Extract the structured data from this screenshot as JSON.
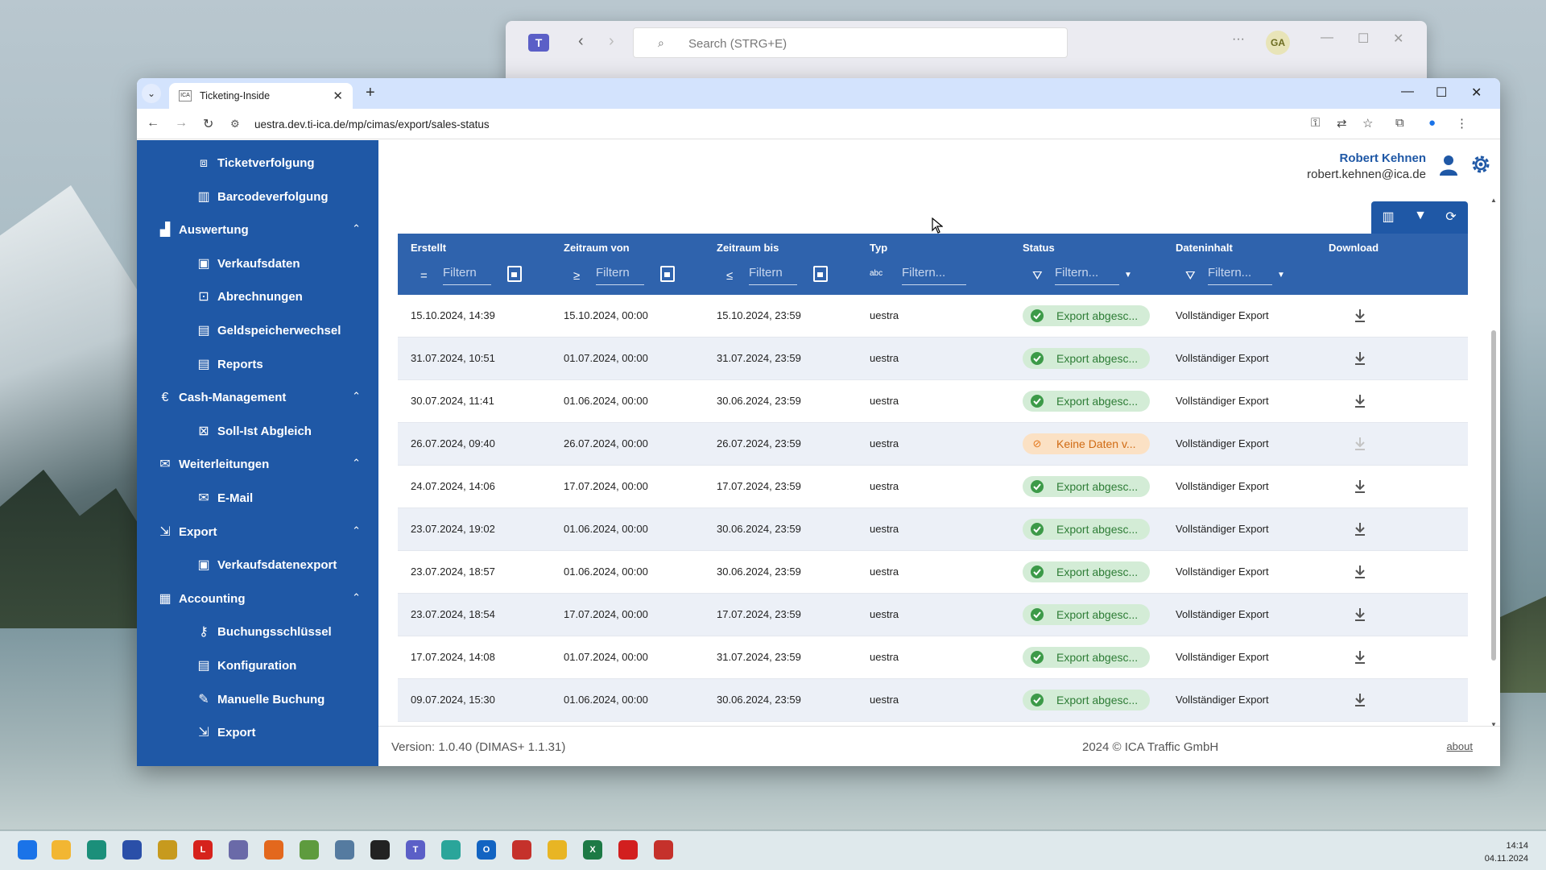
{
  "teams": {
    "search_placeholder": "Search (STRG+E)",
    "avatar_initials": "GA"
  },
  "browser": {
    "tab_title": "Ticketing-Inside",
    "favicon_text": "ICA",
    "url": "uestra.dev.ti-ica.de/mp/cimas/export/sales-status"
  },
  "sidebar": {
    "items": [
      {
        "label": "Ticketverfolgung",
        "icon": "ticket-track-icon",
        "level": 2
      },
      {
        "label": "Barcodeverfolgung",
        "icon": "barcode-icon",
        "level": 2
      },
      {
        "label": "Auswertung",
        "icon": "chart-icon",
        "level": 1,
        "expanded": true
      },
      {
        "label": "Verkaufsdaten",
        "icon": "sales-icon",
        "level": 2
      },
      {
        "label": "Abrechnungen",
        "icon": "billing-icon",
        "level": 2
      },
      {
        "label": "Geldspeicherwechsel",
        "icon": "cash-box-icon",
        "level": 2
      },
      {
        "label": "Reports",
        "icon": "report-icon",
        "level": 2
      },
      {
        "label": "Cash-Management",
        "icon": "euro-icon",
        "level": 1,
        "expanded": true
      },
      {
        "label": "Soll-Ist Abgleich",
        "icon": "reconcile-icon",
        "level": 2
      },
      {
        "label": "Weiterleitungen",
        "icon": "forward-mail-icon",
        "level": 1,
        "expanded": true
      },
      {
        "label": "E-Mail",
        "icon": "email-icon",
        "level": 2
      },
      {
        "label": "Export",
        "icon": "export-icon",
        "level": 1,
        "expanded": true
      },
      {
        "label": "Verkaufsdatenexport",
        "icon": "sales-export-icon",
        "level": 2
      },
      {
        "label": "Accounting",
        "icon": "accounting-icon",
        "level": 1,
        "expanded": true
      },
      {
        "label": "Buchungsschlüssel",
        "icon": "key-icon",
        "level": 2
      },
      {
        "label": "Konfiguration",
        "icon": "config-icon",
        "level": 2
      },
      {
        "label": "Manuelle Buchung",
        "icon": "manual-booking-icon",
        "level": 2
      },
      {
        "label": "Export",
        "icon": "export-icon",
        "level": 2
      }
    ]
  },
  "user": {
    "name": "Robert Kehnen",
    "email": "robert.kehnen@ica.de"
  },
  "table": {
    "columns": [
      {
        "label": "Erstellt",
        "op": "=",
        "filter": "Filtern",
        "type": "date"
      },
      {
        "label": "Zeitraum von",
        "op": "≥",
        "filter": "Filtern",
        "type": "date"
      },
      {
        "label": "Zeitraum bis",
        "op": "≤",
        "filter": "Filtern",
        "type": "date"
      },
      {
        "label": "Typ",
        "op": "abc",
        "filter": "Filtern...",
        "type": "text"
      },
      {
        "label": "Status",
        "op": "⛛",
        "filter": "Filtern...",
        "type": "select"
      },
      {
        "label": "Dateninhalt",
        "op": "⛛",
        "filter": "Filtern...",
        "type": "select"
      },
      {
        "label": "Download",
        "op": "",
        "filter": "",
        "type": "none"
      }
    ],
    "rows": [
      {
        "erstellt": "15.10.2024, 14:39",
        "von": "15.10.2024, 00:00",
        "bis": "15.10.2024, 23:59",
        "typ": "uestra",
        "status": "Export abgesc...",
        "status_kind": "ok",
        "inhalt": "Vollständiger Export",
        "download_enabled": true
      },
      {
        "erstellt": "31.07.2024, 10:51",
        "von": "01.07.2024, 00:00",
        "bis": "31.07.2024, 23:59",
        "typ": "uestra",
        "status": "Export abgesc...",
        "status_kind": "ok",
        "inhalt": "Vollständiger Export",
        "download_enabled": true
      },
      {
        "erstellt": "30.07.2024, 11:41",
        "von": "01.06.2024, 00:00",
        "bis": "30.06.2024, 23:59",
        "typ": "uestra",
        "status": "Export abgesc...",
        "status_kind": "ok",
        "inhalt": "Vollständiger Export",
        "download_enabled": true
      },
      {
        "erstellt": "26.07.2024, 09:40",
        "von": "26.07.2024, 00:00",
        "bis": "26.07.2024, 23:59",
        "typ": "uestra",
        "status": "Keine Daten v...",
        "status_kind": "warn",
        "inhalt": "Vollständiger Export",
        "download_enabled": false
      },
      {
        "erstellt": "24.07.2024, 14:06",
        "von": "17.07.2024, 00:00",
        "bis": "17.07.2024, 23:59",
        "typ": "uestra",
        "status": "Export abgesc...",
        "status_kind": "ok",
        "inhalt": "Vollständiger Export",
        "download_enabled": true
      },
      {
        "erstellt": "23.07.2024, 19:02",
        "von": "01.06.2024, 00:00",
        "bis": "30.06.2024, 23:59",
        "typ": "uestra",
        "status": "Export abgesc...",
        "status_kind": "ok",
        "inhalt": "Vollständiger Export",
        "download_enabled": true
      },
      {
        "erstellt": "23.07.2024, 18:57",
        "von": "01.06.2024, 00:00",
        "bis": "30.06.2024, 23:59",
        "typ": "uestra",
        "status": "Export abgesc...",
        "status_kind": "ok",
        "inhalt": "Vollständiger Export",
        "download_enabled": true
      },
      {
        "erstellt": "23.07.2024, 18:54",
        "von": "17.07.2024, 00:00",
        "bis": "17.07.2024, 23:59",
        "typ": "uestra",
        "status": "Export abgesc...",
        "status_kind": "ok",
        "inhalt": "Vollständiger Export",
        "download_enabled": true
      },
      {
        "erstellt": "17.07.2024, 14:08",
        "von": "01.07.2024, 00:00",
        "bis": "31.07.2024, 23:59",
        "typ": "uestra",
        "status": "Export abgesc...",
        "status_kind": "ok",
        "inhalt": "Vollständiger Export",
        "download_enabled": true
      },
      {
        "erstellt": "09.07.2024, 15:30",
        "von": "01.06.2024, 00:00",
        "bis": "30.06.2024, 23:59",
        "typ": "uestra",
        "status": "Export abgesc...",
        "status_kind": "ok",
        "inhalt": "Vollständiger Export",
        "download_enabled": true
      }
    ]
  },
  "footer": {
    "version": "Version: 1.0.40 (DIMAS+ 1.1.31)",
    "copyright": "2024 © ICA Traffic GmbH",
    "about": "about"
  },
  "taskbar": {
    "time": "14:14",
    "date": "04.11.2024"
  },
  "colors": {
    "sidebar": "#1f58a6",
    "header": "#2f63ad",
    "ok_badge": "#d3ecd6",
    "warn_badge": "#fbe1c4"
  }
}
